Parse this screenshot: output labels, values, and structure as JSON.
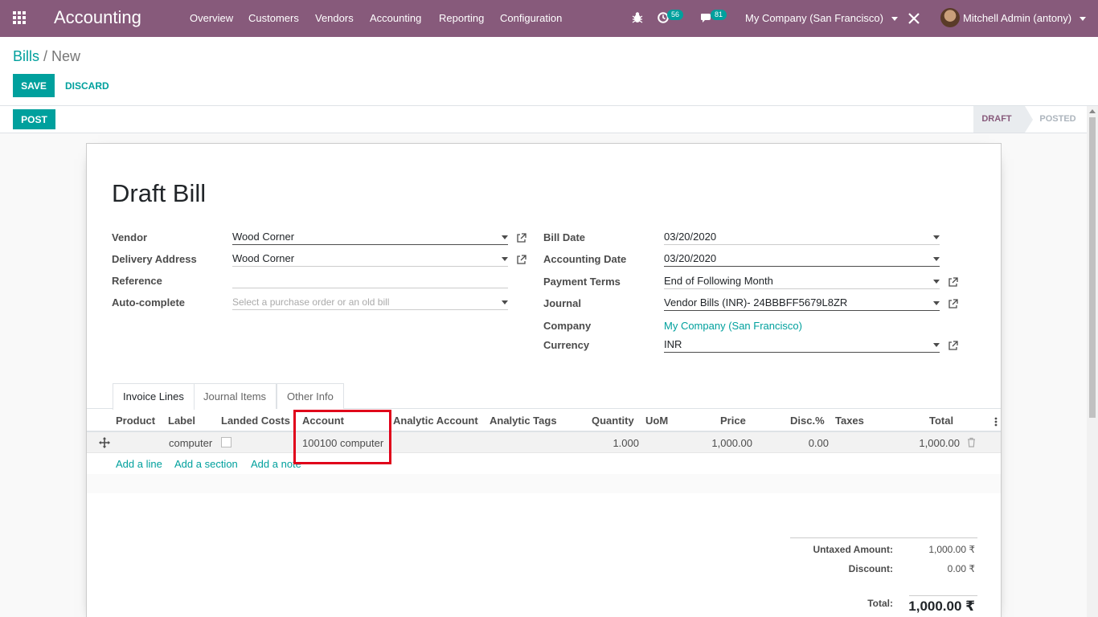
{
  "navbar": {
    "app_name": "Accounting",
    "menus": [
      "Overview",
      "Customers",
      "Vendors",
      "Accounting",
      "Reporting",
      "Configuration"
    ],
    "activity_count": "56",
    "message_count": "81",
    "company": "My Company (San Francisco)",
    "user": "Mitchell Admin (antony)"
  },
  "breadcrumb": {
    "parent": "Bills",
    "current": "New"
  },
  "buttons": {
    "save": "Save",
    "discard": "Discard",
    "post": "Post"
  },
  "status": {
    "draft": "Draft",
    "posted": "Posted"
  },
  "form": {
    "title": "Draft Bill",
    "left": {
      "vendor_label": "Vendor",
      "vendor_value": "Wood Corner",
      "delivery_label": "Delivery Address",
      "delivery_value": "Wood Corner",
      "reference_label": "Reference",
      "reference_value": "",
      "autocomplete_label": "Auto-complete",
      "autocomplete_placeholder": "Select a purchase order or an old bill"
    },
    "right": {
      "bill_date_label": "Bill Date",
      "bill_date_value": "03/20/2020",
      "accounting_date_label": "Accounting Date",
      "accounting_date_value": "03/20/2020",
      "payment_terms_label": "Payment Terms",
      "payment_terms_value": "End of Following Month",
      "journal_label": "Journal",
      "journal_value": "Vendor Bills (INR)- 24BBBFF5679L8ZR",
      "company_label": "Company",
      "company_value": "My Company (San Francisco)",
      "currency_label": "Currency",
      "currency_value": "INR"
    }
  },
  "tabs": [
    "Invoice Lines",
    "Journal Items",
    "Other Info"
  ],
  "lines": {
    "columns": [
      "Product",
      "Label",
      "Landed Costs",
      "Account",
      "Analytic Account",
      "Analytic Tags",
      "Quantity",
      "UoM",
      "Price",
      "Disc.%",
      "Taxes",
      "Total"
    ],
    "rows": [
      {
        "product": "",
        "label": "computer",
        "landed_costs": false,
        "account": "100100 computer",
        "analytic_account": "",
        "analytic_tags": "",
        "quantity": "1.000",
        "uom": "",
        "price": "1,000.00",
        "discount": "0.00",
        "taxes": "",
        "total": "1,000.00"
      }
    ],
    "add_line": "Add a line",
    "add_section": "Add a section",
    "add_note": "Add a note"
  },
  "totals": {
    "untaxed_label": "Untaxed Amount:",
    "untaxed_value": "1,000.00 ₹",
    "discount_label": "Discount:",
    "discount_value": "0.00 ₹",
    "total_label": "Total:",
    "total_value": "1,000.00 ₹"
  },
  "colors": {
    "brand": "#875a7b",
    "accent": "#00a09d",
    "highlight": "#e0001a"
  }
}
